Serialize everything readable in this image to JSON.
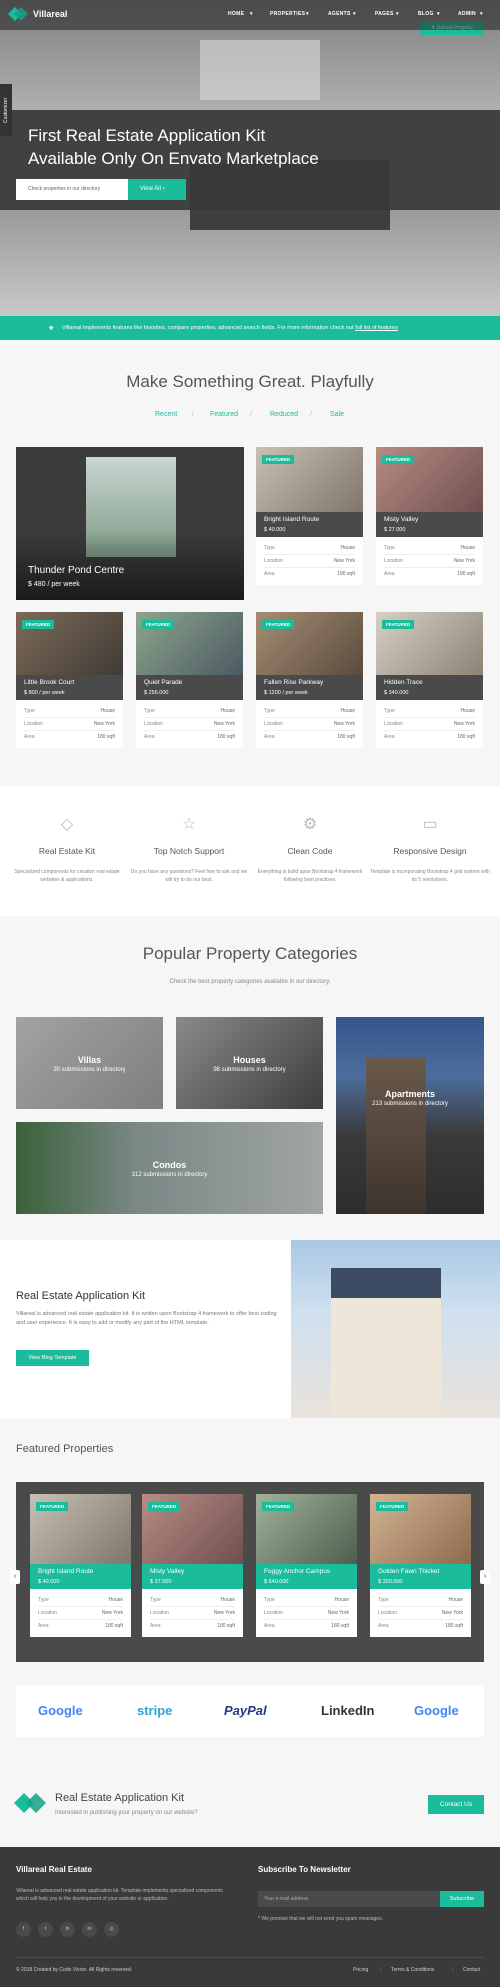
{
  "nav": {
    "brand": "Villareal",
    "items": [
      "HOME",
      "PROPERTIES",
      "AGENTS",
      "PAGES",
      "BLOG",
      "ADMIN"
    ],
    "upload_label": "Upload Property"
  },
  "hero": {
    "customizer_label": "Customizer",
    "title_line1": "First Real Estate Application Kit",
    "title_line2": "Available Only On Envato Marketplace",
    "search_placeholder": "Check properties in our directory",
    "view_all_label": "View All"
  },
  "info_bar": {
    "text": "Villareal implements features like favorites, compare properties, advanced search fields. For more information check out ",
    "link": "full list of features"
  },
  "make_section": {
    "title": "Make Something Great. Playfully",
    "filters": [
      "Recent",
      "Featured",
      "Reduced",
      "Sale"
    ]
  },
  "big_card": {
    "title": "Thunder Pond Centre",
    "price": "$ 480 / per week"
  },
  "listings": [
    {
      "featured": "FEATURED",
      "title": "Bright Island Route",
      "price": "$ 40.000",
      "type": "House",
      "location": "New York",
      "area": "180 sqft"
    },
    {
      "featured": "FEATURED",
      "title": "Misty Valley",
      "price": "$ 27.000",
      "type": "House",
      "location": "New York",
      "area": "180 sqft"
    },
    {
      "featured": "FEATURED",
      "title": "Little Brook Court",
      "price": "$ 800 / per week",
      "type": "House",
      "location": "New York",
      "area": "180 sqft"
    },
    {
      "featured": "FEATURED",
      "title": "Quiet Parade",
      "price": "$ 256.000",
      "type": "House",
      "location": "New York",
      "area": "180 sqft"
    },
    {
      "featured": "FEATURED",
      "title": "Fallen Rise Parkway",
      "price": "$ 1200 / per week",
      "type": "House",
      "location": "New York",
      "area": "180 sqft"
    },
    {
      "featured": "FEATURED",
      "title": "Hidden Trace",
      "price": "$ 340.000",
      "type": "House",
      "location": "New York",
      "area": "180 sqft"
    }
  ],
  "spec_labels": {
    "type": "Type",
    "location": "Location",
    "area": "Area"
  },
  "features": [
    {
      "title": "Real Estate Kit",
      "text": "Specialized components for creation real estate websites & applications."
    },
    {
      "title": "Top Notch Support",
      "text": "Do you have any questions? Feel free to ask and we will try to do our best."
    },
    {
      "title": "Clean Code",
      "text": "Everything is build upon Bootstrap 4 framework following best practises."
    },
    {
      "title": "Responsive Design",
      "text": "Template is incorporating Bootstrap 4 grid system with its 5 resolutions."
    }
  ],
  "categories_section": {
    "title": "Popular Property Categories",
    "subtitle": "Check the best property categories available in our directory.",
    "items": [
      {
        "name": "Villas",
        "count": "30 submissions in directory"
      },
      {
        "name": "Houses",
        "count": "98 submissions in directory"
      },
      {
        "name": "Apartments",
        "count": "213 submissions in directory"
      },
      {
        "name": "Condos",
        "count": "312 submissions in directory"
      }
    ]
  },
  "about": {
    "title": "Real Estate Application Kit",
    "text": "Villareal is advanced real estate application kit. It is written upon Bootstrap 4 framework to offer best coding and user experience. It is easy to add or modify any part of the HTML template.",
    "button": "View Blog Template"
  },
  "featured_props": {
    "title": "Featured Properties",
    "items": [
      {
        "featured": "FEATURED",
        "title": "Bright Island Route",
        "price": "$ 40.000",
        "type": "House",
        "location": "New York",
        "area": "180 sqft"
      },
      {
        "featured": "FEATURED",
        "title": "Misty Valley",
        "price": "$ 27.000",
        "type": "House",
        "location": "New York",
        "area": "180 sqft"
      },
      {
        "featured": "FEATURED",
        "title": "Foggy Anchor Campus",
        "price": "$ 640.000",
        "type": "House",
        "location": "New York",
        "area": "180 sqft"
      },
      {
        "featured": "FEATURED",
        "title": "Golden Fawn Thicket",
        "price": "$ 320.000",
        "type": "House",
        "location": "New York",
        "area": "180 sqft"
      }
    ]
  },
  "brands": [
    "Google",
    "stripe",
    "PayPal",
    "LinkedIn",
    "Google"
  ],
  "cta": {
    "title": "Real Estate Application Kit",
    "subtitle": "Interested in publishing your property on our website?",
    "button": "Contact Us"
  },
  "footer": {
    "about_title": "Villareal Real Estate",
    "about_text": "Villareal is advanced real estate application kit. Template implements specialized components which will help you in the development of your website or application.",
    "newsletter_title": "Subscribe To Newsletter",
    "newsletter_placeholder": "Your e-mail address",
    "newsletter_button": "Subscribe",
    "newsletter_note": "* We promise that we will not send you spam messages.",
    "copyright": "© 2018 Created by Code Vision. All Rights reserved.",
    "links": [
      "Pricing",
      "Terms & Conditions",
      "Contact"
    ]
  },
  "colors": {
    "accent": "#1abc9c",
    "dark": "#3a3a3a"
  }
}
